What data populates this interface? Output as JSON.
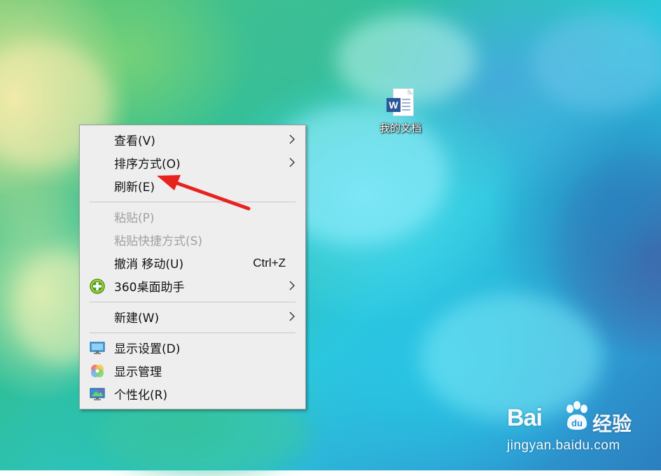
{
  "desktop": {
    "icons": [
      {
        "label": "我的文档",
        "icon": "word-document-icon",
        "badge": "W"
      }
    ]
  },
  "context_menu": {
    "items": [
      {
        "label": "查看(V)",
        "submenu": true,
        "enabled": true
      },
      {
        "label": "排序方式(O)",
        "submenu": true,
        "enabled": true
      },
      {
        "label": "刷新(E)",
        "submenu": false,
        "enabled": true
      },
      {
        "label": "粘贴(P)",
        "submenu": false,
        "enabled": false
      },
      {
        "label": "粘贴快捷方式(S)",
        "submenu": false,
        "enabled": false
      },
      {
        "label": "撤消 移动(U)",
        "shortcut": "Ctrl+Z",
        "submenu": false,
        "enabled": true
      },
      {
        "label": "360桌面助手",
        "icon": "360-plus-icon",
        "submenu": true,
        "enabled": true
      },
      {
        "label": "新建(W)",
        "submenu": true,
        "enabled": true
      },
      {
        "label": "显示设置(D)",
        "icon": "display-settings-icon",
        "submenu": false,
        "enabled": true
      },
      {
        "label": "显示管理",
        "icon": "color-wheel-icon",
        "submenu": false,
        "enabled": true
      },
      {
        "label": "个性化(R)",
        "icon": "personalize-monitor-icon",
        "submenu": false,
        "enabled": true
      }
    ]
  },
  "annotation": {
    "arrow_color": "#e8231f",
    "points_to": "刷新(E)"
  },
  "watermark": {
    "brand": "Bai",
    "brand_suffix": "经验",
    "url": "jingyan.baidu.com"
  }
}
